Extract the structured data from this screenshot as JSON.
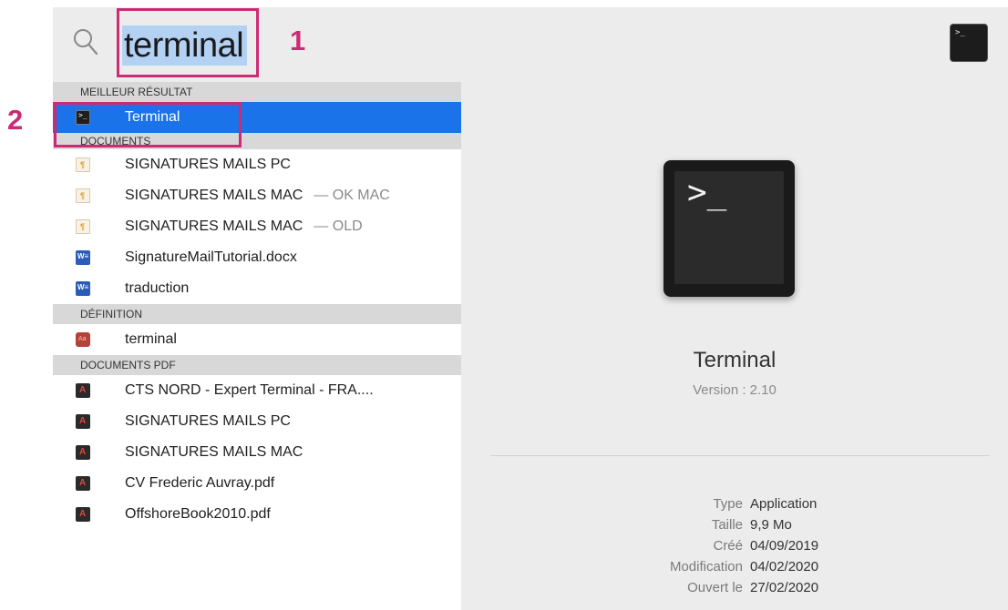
{
  "search": {
    "query": "terminal",
    "top_icon_glyph": ">_"
  },
  "sections": {
    "best": "MEILLEUR RÉSULTAT",
    "documents": "DOCUMENTS",
    "definition": "DÉFINITION",
    "pdf": "DOCUMENTS PDF"
  },
  "best_result": {
    "label": "Terminal"
  },
  "documents": [
    {
      "label": "SIGNATURES MAILS PC",
      "suffix": ""
    },
    {
      "label": "SIGNATURES MAILS MAC",
      "suffix": "— OK MAC"
    },
    {
      "label": "SIGNATURES MAILS MAC",
      "suffix": "— OLD"
    },
    {
      "label": "SignatureMailTutorial.docx",
      "suffix": ""
    },
    {
      "label": "traduction",
      "suffix": ""
    }
  ],
  "definition": [
    {
      "label": "terminal"
    }
  ],
  "pdfs": [
    {
      "label": "CTS NORD - Expert Terminal - FRA...."
    },
    {
      "label": "SIGNATURES MAILS PC"
    },
    {
      "label": "SIGNATURES MAILS MAC"
    },
    {
      "label": "CV Frederic Auvray.pdf"
    },
    {
      "label": "OffshoreBook2010.pdf"
    }
  ],
  "preview": {
    "icon_glyph": ">_",
    "name": "Terminal",
    "version": "Version : 2.10",
    "meta": [
      {
        "key": "Type",
        "value": "Application"
      },
      {
        "key": "Taille",
        "value": "9,9 Mo"
      },
      {
        "key": "Créé",
        "value": "04/09/2019"
      },
      {
        "key": "Modification",
        "value": "04/02/2020"
      },
      {
        "key": "Ouvert le",
        "value": "27/02/2020"
      }
    ]
  },
  "annotations": {
    "one": "1",
    "two": "2",
    "color": "#cc2b74"
  },
  "colors": {
    "selection": "#1a73e8",
    "query_highlight": "#b3d1f2"
  }
}
